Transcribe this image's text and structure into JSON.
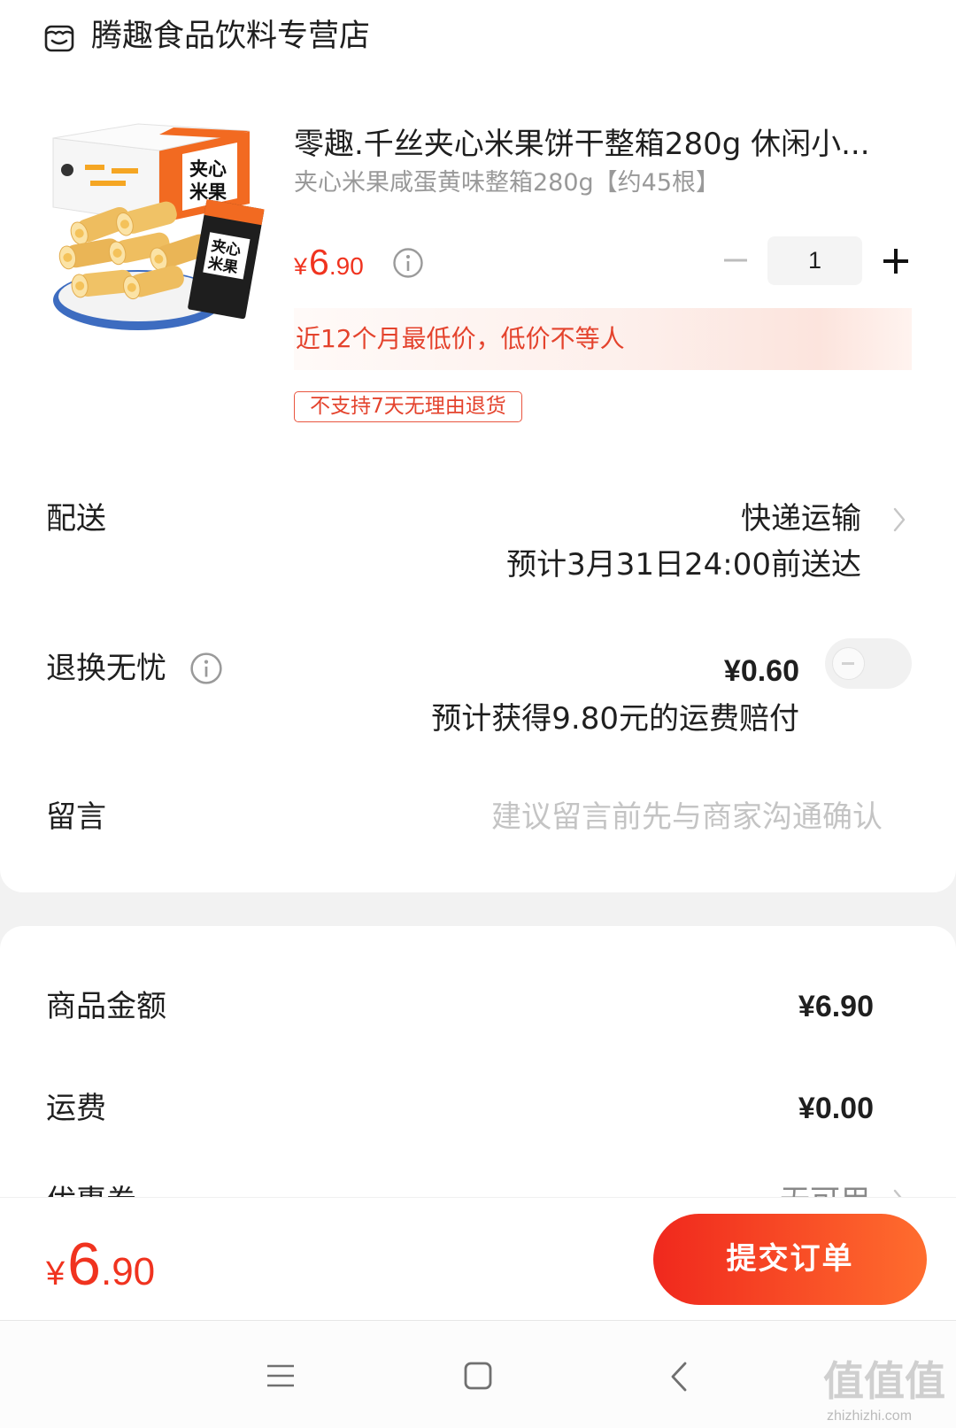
{
  "shop": {
    "name": "腾趣食品饮料专营店",
    "icon": "shop-icon"
  },
  "product": {
    "image": {
      "packaging_text": [
        "夹心",
        "米果"
      ]
    },
    "title": "零趣.千丝夹心米果饼干整箱280g 休闲小...",
    "variant": "夹心米果咸蛋黄味整箱280g【约45根】",
    "price": {
      "currency": "¥",
      "integer": "6",
      "decimal": ".90"
    },
    "quantity": "1",
    "promo_banner": "近12个月最低价，低价不等人",
    "tag": "不支持7天无理由退货"
  },
  "delivery": {
    "label": "配送",
    "method": "快递运输",
    "eta": "预计3月31日24:00前送达"
  },
  "return_insurance": {
    "label": "退换无忧",
    "price": "¥0.60",
    "note": "预计获得9.80元的运费赔付",
    "enabled": false
  },
  "message": {
    "label": "留言",
    "placeholder": "建议留言前先与商家沟通确认",
    "value": ""
  },
  "summary": {
    "items": [
      {
        "label": "商品金额",
        "value": "¥6.90"
      },
      {
        "label": "运费",
        "value": "¥0.00"
      },
      {
        "label": "优惠券",
        "value": "无可用"
      }
    ]
  },
  "footer": {
    "total": {
      "currency": "¥",
      "integer": "6",
      "decimal": ".90"
    },
    "submit_label": "提交订单"
  },
  "nav_bar": {
    "icons": [
      "menu-icon",
      "home-icon",
      "back-icon"
    ]
  },
  "watermark": {
    "logo": "值值值",
    "site": "zhizhizhi.com"
  },
  "colors": {
    "accent": "#f0331f",
    "button_gradient_start": "#f0281d",
    "button_gradient_end": "#ff6d2e",
    "text": "#1f1f1f",
    "muted": "#999999",
    "placeholder": "#c4c4c4",
    "page_bg": "#f2f2f2"
  }
}
